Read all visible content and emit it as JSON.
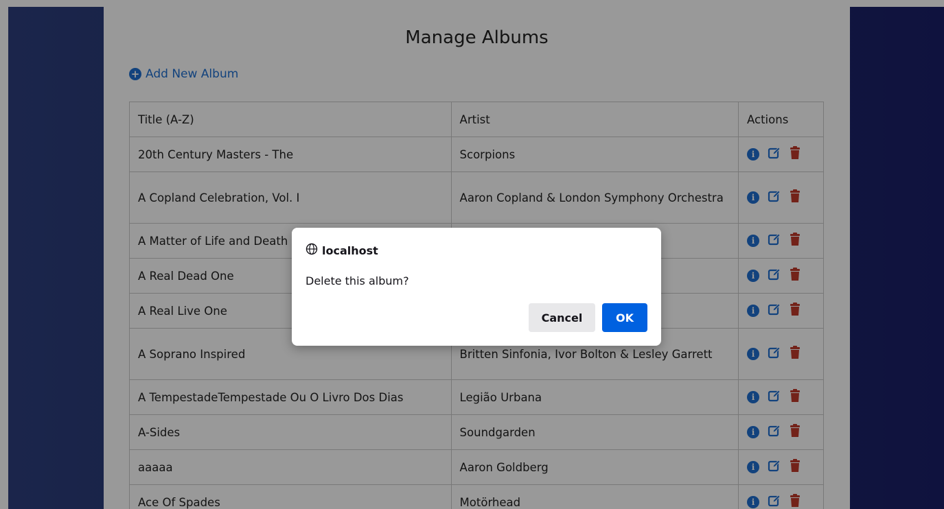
{
  "page": {
    "title": "Manage Albums",
    "add_link": "Add New Album"
  },
  "table": {
    "headers": [
      "Title (A-Z)",
      "Artist",
      "Actions"
    ],
    "rows": [
      {
        "title": "20th Century Masters - The",
        "artist": "Scorpions"
      },
      {
        "title": "A Copland Celebration, Vol. I",
        "artist": "Aaron Copland & London Symphony Orchestra"
      },
      {
        "title": "A Matter of Life and Death",
        "artist": ""
      },
      {
        "title": "A Real Dead One",
        "artist": ""
      },
      {
        "title": "A Real Live One",
        "artist": ""
      },
      {
        "title": "A Soprano Inspired",
        "artist": "Britten Sinfonia, Ivor Bolton & Lesley Garrett"
      },
      {
        "title": "A TempestadeTempestade Ou O Livro Dos Dias",
        "artist": "Legião Urbana"
      },
      {
        "title": "A-Sides",
        "artist": "Soundgarden"
      },
      {
        "title": "aaaaa",
        "artist": "Aaron Goldberg"
      },
      {
        "title": "Ace Of Spades",
        "artist": "Motörhead"
      }
    ]
  },
  "dialog": {
    "origin": "localhost",
    "message": "Delete this album?",
    "cancel_label": "Cancel",
    "ok_label": "OK"
  },
  "icons": {
    "add": "plus-circle-icon",
    "info": "info-circle-icon",
    "edit": "edit-icon",
    "delete": "trash-icon",
    "origin": "globe-icon"
  },
  "colors": {
    "background_left": "#2d3f7e",
    "background_right": "#1a1f68",
    "link": "#1f6fd0",
    "info_icon": "#1f6fd0",
    "edit_icon": "#1f6fd0",
    "delete_icon": "#c0392b",
    "ok_button": "#0061e0"
  }
}
